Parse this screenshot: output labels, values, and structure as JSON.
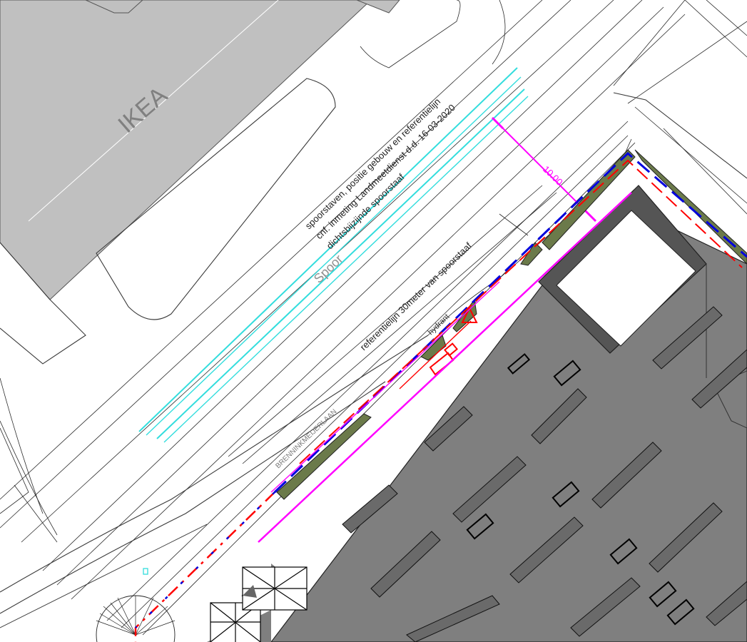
{
  "labels": {
    "ikea": "IKEA",
    "survey_line_1": "spoorstaven, positie gebouw en referentielijn",
    "survey_line_2": "cnf. inmeting Landmeetdienst d.d. 16-03-2020",
    "survey_line_3": "dichtsbijzijnde spoorstaaf",
    "rail": "Spoor",
    "reference_line": "referentielijn 30meter van spoorstaaf",
    "hydrant": "hydrant",
    "street": "BRENNINKMEIJERLAAN",
    "dimension": "10.00"
  },
  "colors": {
    "background": "#ffffff",
    "ikea_building": "#c0c0c0",
    "parking_building": "#7f7f7f",
    "rail": "#33dddd",
    "reference_line": "#ff00ff",
    "boundary_red": "#ff0000",
    "boundary_blue": "#0000dd",
    "green_strip": "#6b7a4a",
    "linework": "#222222"
  }
}
